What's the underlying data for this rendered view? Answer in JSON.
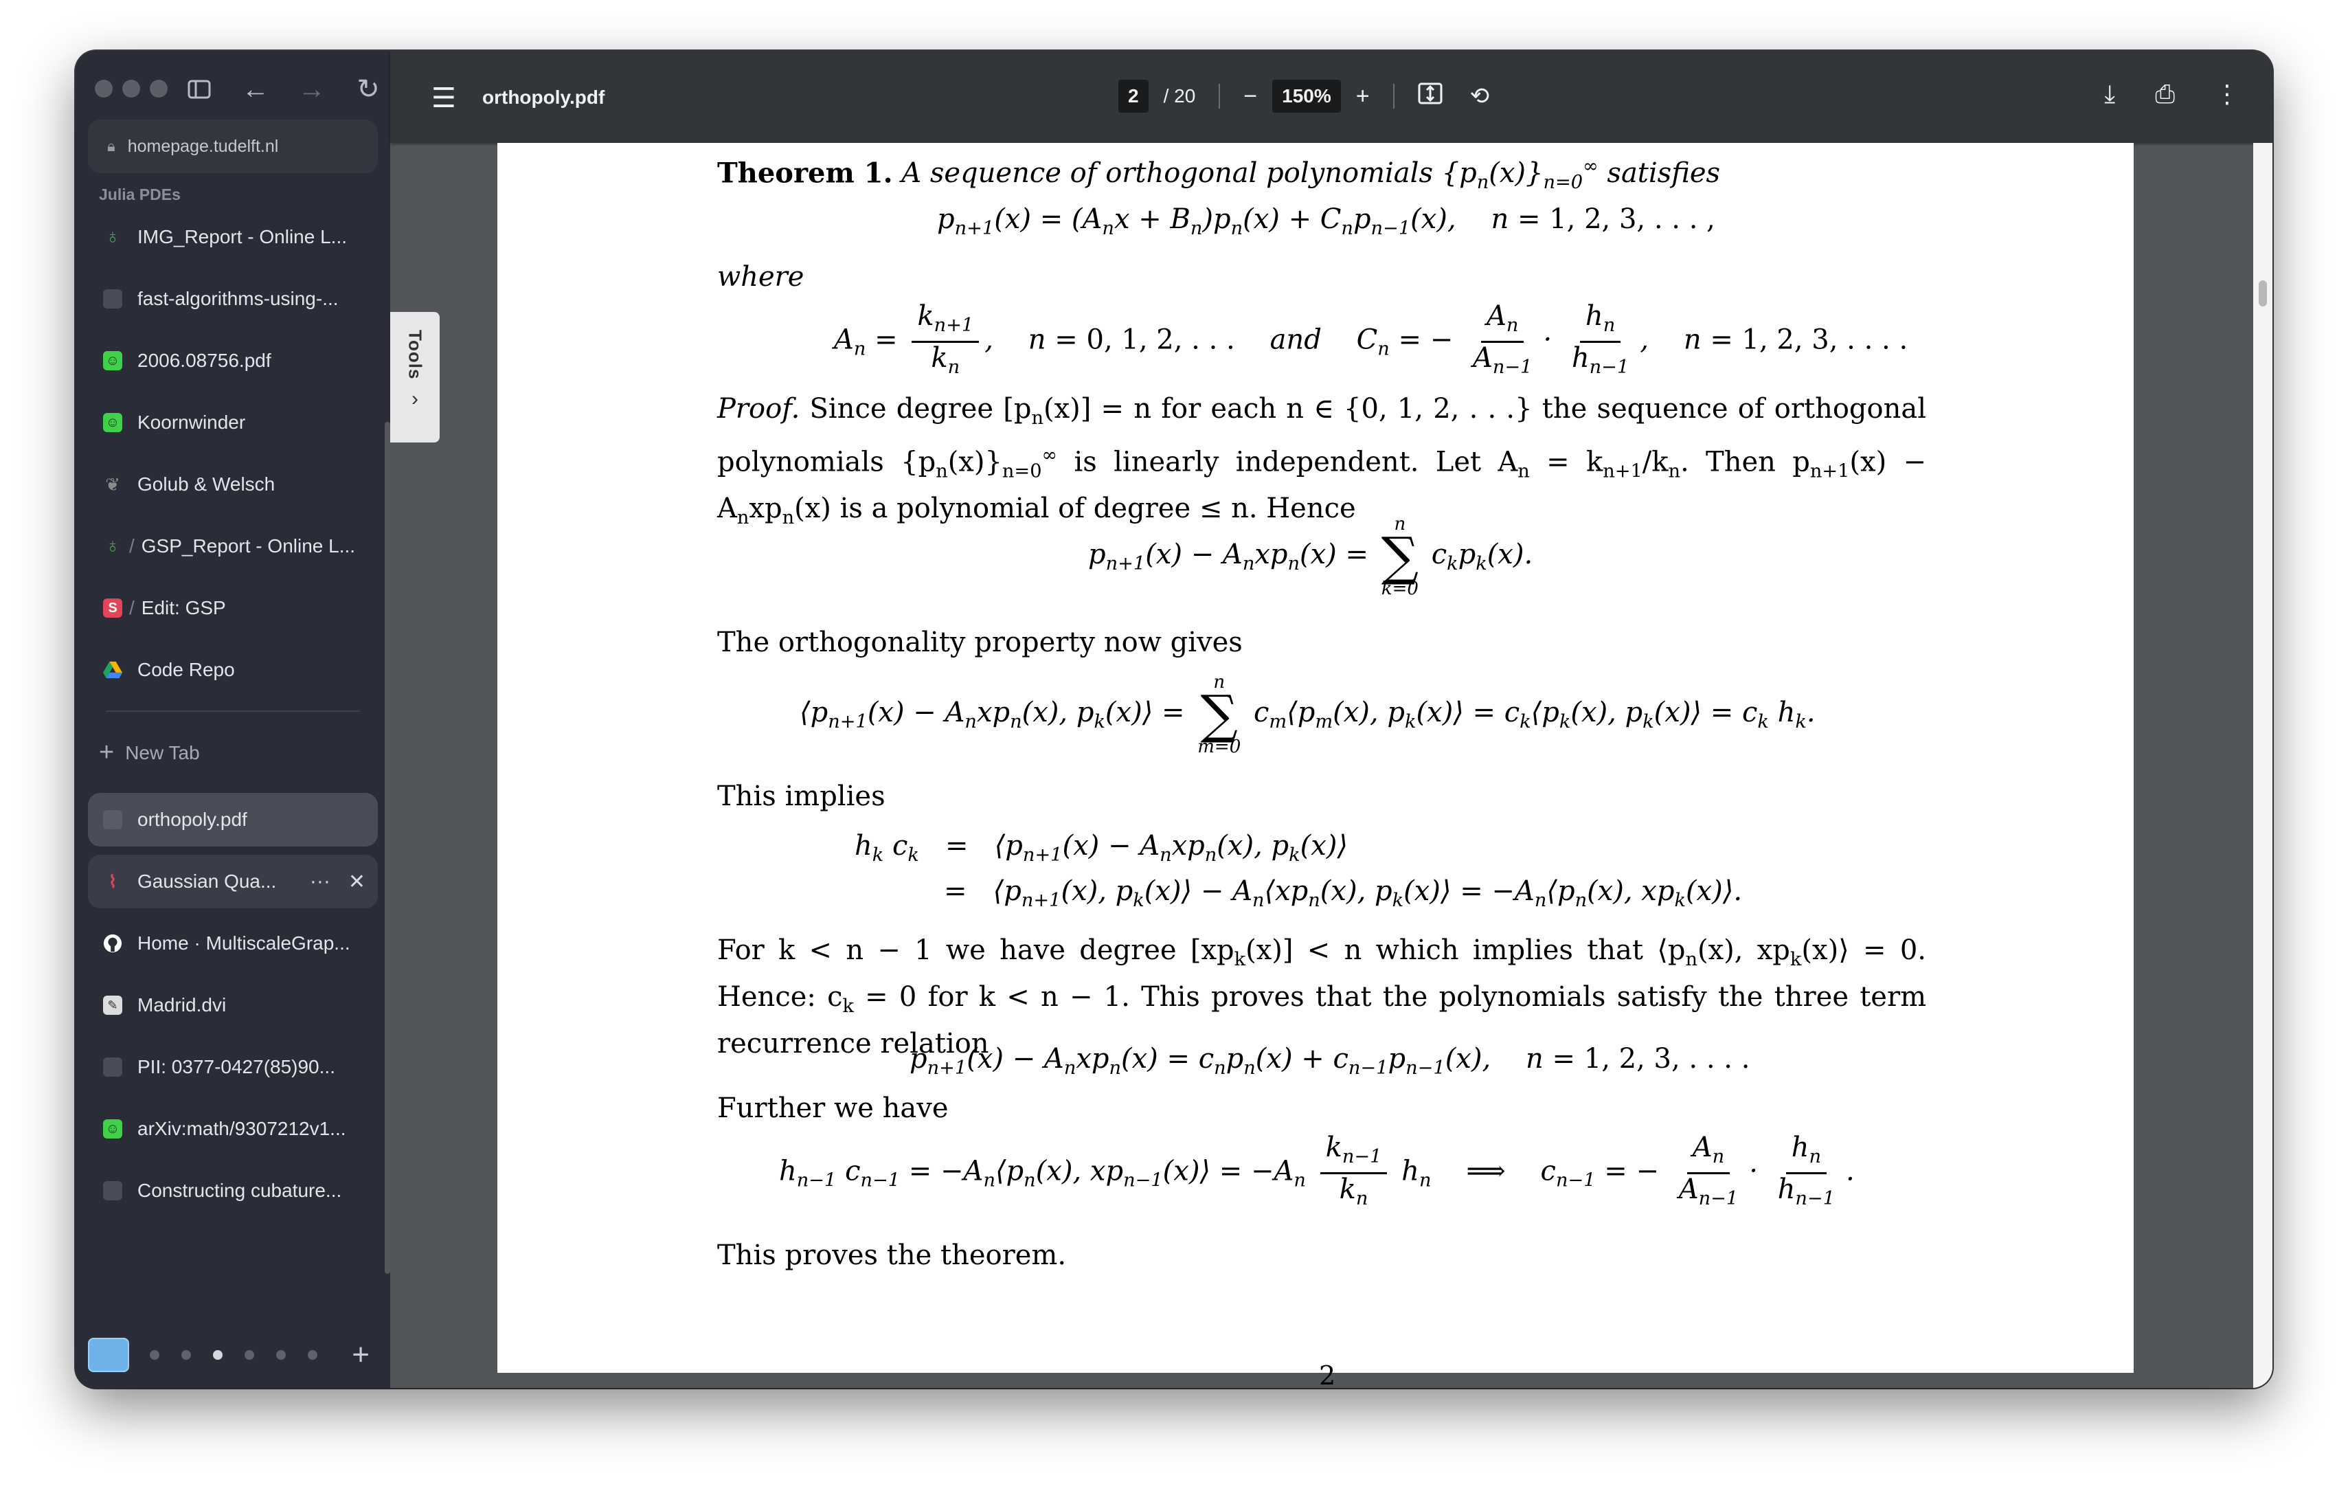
{
  "sidebar": {
    "url": "homepage.tudelft.nl",
    "space_label": "Julia PDEs",
    "pinned_tabs": [
      {
        "label": "IMG_Report - Online L...",
        "icon": "overleaf-icon",
        "color": "#46a34a"
      },
      {
        "label": "fast-algorithms-using-...",
        "icon": "blank-page-icon",
        "color": "#4a4c57"
      },
      {
        "label": "2006.08756.pdf",
        "icon": "smiley-icon",
        "color": "#3fd14a"
      },
      {
        "label": "Koornwinder",
        "icon": "smiley-icon",
        "color": "#3fd14a"
      },
      {
        "label": "Golub & Welsch",
        "icon": "feather-icon",
        "color": "#777"
      },
      {
        "label": "GSP_Report - Online L...",
        "icon": "overleaf-icon",
        "color": "#46a34a"
      },
      {
        "label": "Edit: GSP",
        "icon": "s-logo-icon",
        "color": "#e2455a"
      },
      {
        "label": "Code Repo",
        "icon": "google-drive-icon",
        "color": "#f5b400"
      }
    ],
    "new_tab_label": "New Tab",
    "tabs": [
      {
        "label": "orthopoly.pdf",
        "icon": "blank-page-icon",
        "state": "active",
        "color": "#5a5c67"
      },
      {
        "label": "Gaussian Qua...",
        "icon": "quadrature-icon",
        "state": "hover",
        "color": "#e2455a"
      },
      {
        "label": "Home · MultiscaleGrap...",
        "icon": "github-icon",
        "color": "#ffffff"
      },
      {
        "label": "Madrid.dvi",
        "icon": "document-icon",
        "color": "#dddddd"
      },
      {
        "label": "PII: 0377-0427(85)90...",
        "icon": "blank-page-icon",
        "color": "#4a4c57"
      },
      {
        "label": "arXiv:math/9307212v1...",
        "icon": "smiley-icon",
        "color": "#3fd14a"
      },
      {
        "label": "Constructing cubature...",
        "icon": "blank-page-icon",
        "color": "#4a4c57"
      }
    ],
    "tab_actions": {
      "more": "···",
      "close": "✕"
    }
  },
  "pdf": {
    "title": "orthopoly.pdf",
    "page_current": "2",
    "page_total": "/ 20",
    "zoom": "150%",
    "tools_label": "Tools"
  },
  "doc": {
    "theorem_head": "Theorem 1.",
    "where": "where",
    "and": "and",
    "proof_head": "Proof.",
    "orth_text": "The orthogonality property now gives",
    "implies_text": "This implies",
    "further_text": "Further we have",
    "proves_text": "This proves the theorem.",
    "page_number": "2"
  }
}
